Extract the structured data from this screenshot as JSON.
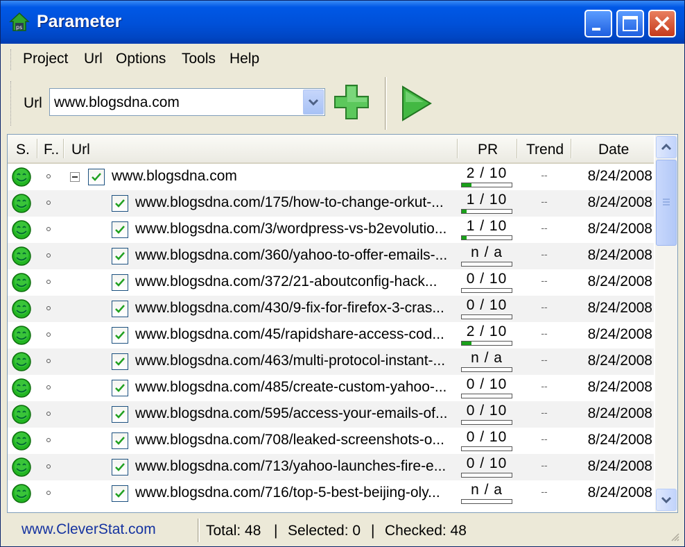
{
  "window": {
    "title": "Parameter"
  },
  "menu": [
    "Project",
    "Url",
    "Options",
    "Tools",
    "Help"
  ],
  "toolbar": {
    "url_label": "Url",
    "url_value": "www.blogsdna.com"
  },
  "columns": {
    "status": "S.",
    "flag": "F..",
    "url": "Url",
    "pr": "PR",
    "trend": "Trend",
    "date": "Date"
  },
  "rows": [
    {
      "url": "www.blogsdna.com",
      "pr": "2 / 10",
      "pr_fraction": 0.2,
      "trend": "--",
      "date": "8/24/2008",
      "root": true
    },
    {
      "url": "www.blogsdna.com/175/how-to-change-orkut-...",
      "pr": "1 / 10",
      "pr_fraction": 0.1,
      "trend": "--",
      "date": "8/24/2008"
    },
    {
      "url": "www.blogsdna.com/3/wordpress-vs-b2evolutio...",
      "pr": "1 / 10",
      "pr_fraction": 0.1,
      "trend": "--",
      "date": "8/24/2008"
    },
    {
      "url": "www.blogsdna.com/360/yahoo-to-offer-emails-...",
      "pr": "n / a",
      "pr_fraction": 0,
      "trend": "--",
      "date": "8/24/2008"
    },
    {
      "url": "www.blogsdna.com/372/21-aboutconfig-hack...",
      "pr": "0 / 10",
      "pr_fraction": 0,
      "trend": "--",
      "date": "8/24/2008"
    },
    {
      "url": "www.blogsdna.com/430/9-fix-for-firefox-3-cras...",
      "pr": "0 / 10",
      "pr_fraction": 0,
      "trend": "--",
      "date": "8/24/2008"
    },
    {
      "url": "www.blogsdna.com/45/rapidshare-access-cod...",
      "pr": "2 / 10",
      "pr_fraction": 0.2,
      "trend": "--",
      "date": "8/24/2008"
    },
    {
      "url": "www.blogsdna.com/463/multi-protocol-instant-...",
      "pr": "n / a",
      "pr_fraction": 0,
      "trend": "--",
      "date": "8/24/2008"
    },
    {
      "url": "www.blogsdna.com/485/create-custom-yahoo-...",
      "pr": "0 / 10",
      "pr_fraction": 0,
      "trend": "--",
      "date": "8/24/2008"
    },
    {
      "url": "www.blogsdna.com/595/access-your-emails-of...",
      "pr": "0 / 10",
      "pr_fraction": 0,
      "trend": "--",
      "date": "8/24/2008"
    },
    {
      "url": "www.blogsdna.com/708/leaked-screenshots-o...",
      "pr": "0 / 10",
      "pr_fraction": 0,
      "trend": "--",
      "date": "8/24/2008"
    },
    {
      "url": "www.blogsdna.com/713/yahoo-launches-fire-e...",
      "pr": "0 / 10",
      "pr_fraction": 0,
      "trend": "--",
      "date": "8/24/2008"
    },
    {
      "url": "www.blogsdna.com/716/top-5-best-beijing-oly...",
      "pr": "n / a",
      "pr_fraction": 0,
      "trend": "--",
      "date": "8/24/2008"
    }
  ],
  "status_bar": {
    "link": "www.CleverStat.com",
    "total": "Total: 48",
    "selected": "Selected: 0",
    "checked": "Checked: 48"
  },
  "colors": {
    "title_bar": "#0054e3",
    "pr_fill": "#1aa01a",
    "status_ok": "#22b522",
    "link": "#1533a0"
  },
  "icons": {
    "app": "house-icon",
    "add": "plus-icon",
    "go": "play-icon",
    "status": "smiley-icon"
  }
}
